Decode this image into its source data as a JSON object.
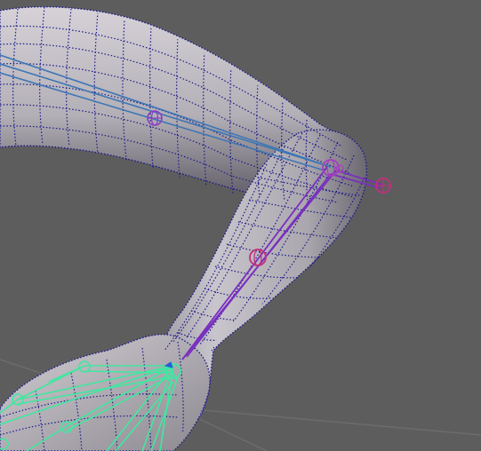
{
  "scene": {
    "background_color": "#5d5d5d",
    "grid_color": "#6c6c6c",
    "mesh_fill_color": "#b5b1b6",
    "mesh_shadow_color": "#4a4750",
    "wire_color": "#1a1a8a",
    "humerus_bone_color": "#3d76b5",
    "arm_bone_color": "#7a2fbf",
    "elbow_joint_color": "#a43fc0",
    "ik_handle_color": "#c0307a",
    "hand_bone_color": "#3fe8a0"
  },
  "icons": {
    "shoulder_twist_joint": "joint-circle-icon",
    "elbow_joint": "joint-circle-icon",
    "elbow_pole_handle": "ik-pole-handle-icon",
    "forearm_twist_joint": "joint-circle-icon",
    "wrist_joint": "joint-circle-icon"
  }
}
